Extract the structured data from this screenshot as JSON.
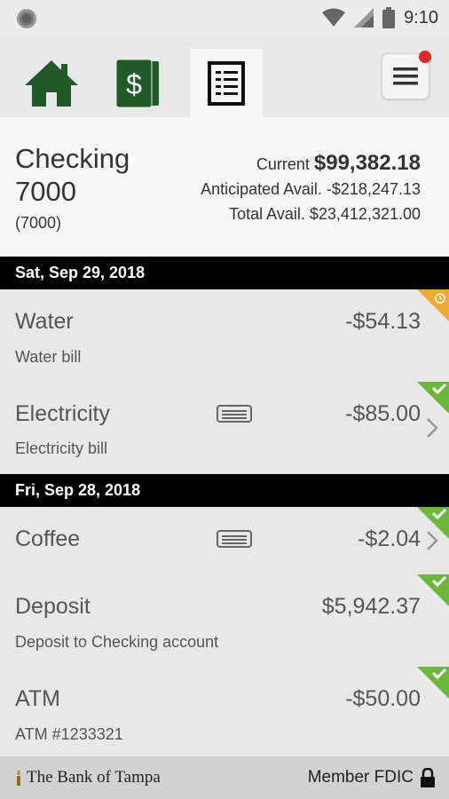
{
  "status_bar": {
    "time": "9:10",
    "icons": [
      "notification-dot-icon",
      "wifi-icon",
      "signal-icon",
      "battery-icon"
    ]
  },
  "nav": {
    "tabs": [
      {
        "name": "home-icon"
      },
      {
        "name": "dollar-bill-icon"
      },
      {
        "name": "register-icon",
        "active": true
      }
    ],
    "menu_icon": "hamburger-menu-icon",
    "brand_color": "#1f5a28"
  },
  "account": {
    "name": "Checking 7000",
    "number": "(7000)",
    "current_label": "Current",
    "current_value": "$99,382.18",
    "anticipated_label": "Anticipated Avail.",
    "anticipated_value": "-$218,247.13",
    "total_label": "Total Avail.",
    "total_value": "$23,412,321.00"
  },
  "groups": [
    {
      "date": "Sat, Sep 29, 2018",
      "transactions": [
        {
          "name": "Water",
          "description": "Water bill",
          "amount": "-$54.13",
          "status": "pending"
        },
        {
          "name": "Electricity",
          "description": "Electricity bill",
          "amount": "-$85.00",
          "status": "cleared",
          "has_memo": true,
          "has_chevron": true
        }
      ]
    },
    {
      "date": "Fri, Sep 28, 2018",
      "transactions": [
        {
          "name": "Coffee",
          "description": "",
          "amount": "-$2.04",
          "status": "cleared",
          "has_memo": true,
          "has_chevron": true
        },
        {
          "name": "Deposit",
          "description": "Deposit to Checking account",
          "amount": "$5,942.37",
          "status": "cleared"
        },
        {
          "name": "ATM",
          "description": "ATM #1233321",
          "amount": "-$50.00",
          "status": "cleared"
        }
      ]
    }
  ],
  "footer": {
    "bank_name": "The Bank of Tampa",
    "fdic": "Member FDIC"
  },
  "colors": {
    "pending": "#f0a830",
    "cleared": "#6cb83a",
    "header_bg": "#000000"
  }
}
